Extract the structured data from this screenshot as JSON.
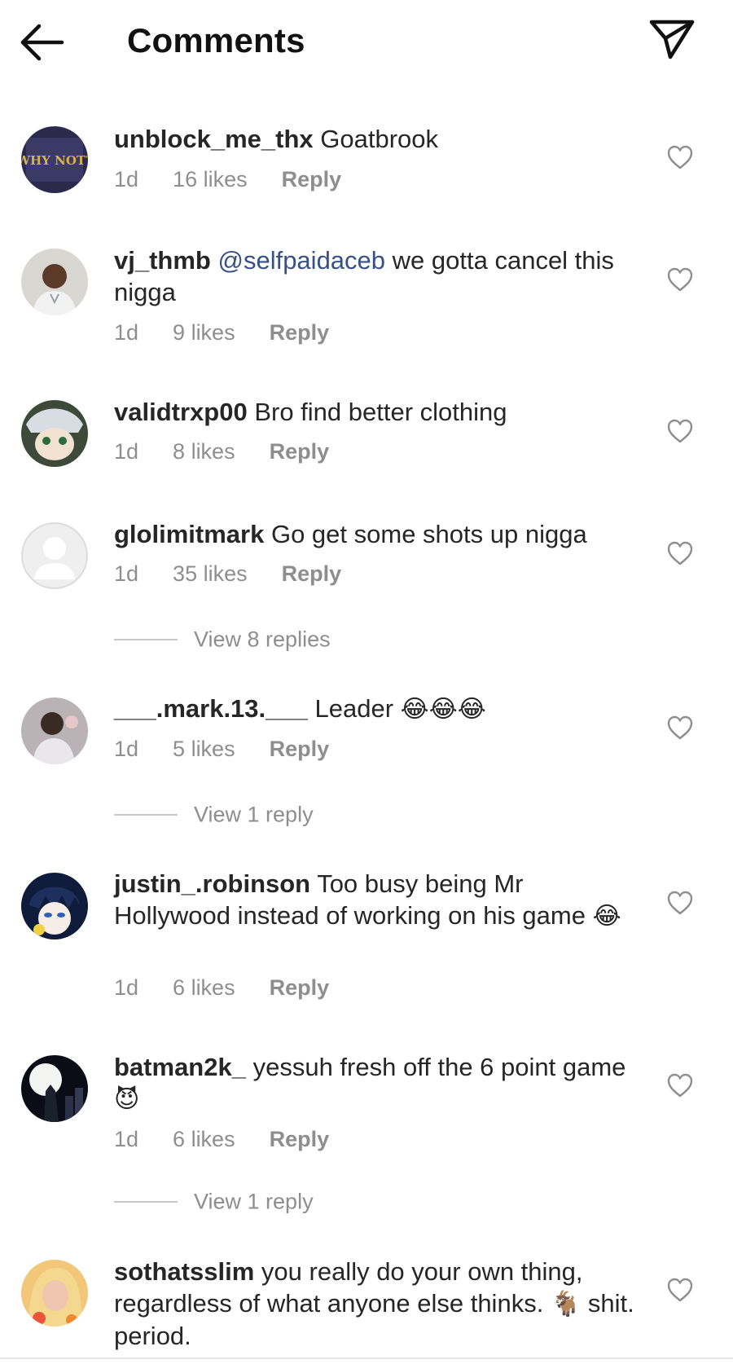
{
  "header": {
    "title": "Comments"
  },
  "comments": [
    {
      "username": "unblock_me_thx",
      "text": "Goatbrook",
      "time": "1d",
      "likes": "16 likes",
      "reply": "Reply"
    },
    {
      "username": "vj_thmb",
      "mention": "@selfpaidaceb",
      "text": "we gotta cancel this nigga",
      "time": "1d",
      "likes": "9 likes",
      "reply": "Reply"
    },
    {
      "username": "validtrxp00",
      "text": "Bro find better clothing",
      "time": "1d",
      "likes": "8 likes",
      "reply": "Reply"
    },
    {
      "username": "glolimitmark",
      "text": "Go get some shots up nigga",
      "time": "1d",
      "likes": "35 likes",
      "reply": "Reply",
      "view_replies": "View 8 replies"
    },
    {
      "username": "___.mark.13.___",
      "text": "Leader",
      "emoji": "😂😂😂",
      "time": "1d",
      "likes": "5 likes",
      "reply": "Reply",
      "view_replies": "View 1 reply"
    },
    {
      "username": "justin_.robinson",
      "text": "Too busy being Mr Hollywood instead of  working on his game",
      "emoji": "😂",
      "time": "1d",
      "likes": "6 likes",
      "reply": "Reply"
    },
    {
      "username": "batman2k_",
      "text": "yessuh fresh off the 6 point game",
      "emoji": "😈",
      "time": "1d",
      "likes": "6 likes",
      "reply": "Reply",
      "view_replies": "View 1 reply"
    },
    {
      "username": "sothatsslim",
      "text": "you really do your own thing, regardless of what anyone else thinks.",
      "emoji": "🐐",
      "text2": "shit. period."
    }
  ],
  "avatars": {
    "c0": "WHY NOT?"
  },
  "icons": {
    "back": "arrow-left-icon",
    "send": "paper-plane-icon",
    "heart": "heart-outline-icon"
  },
  "colors": {
    "text": "#262626",
    "meta": "#8e8e8e",
    "mention": "#385185",
    "divider": "#c7c7c7"
  }
}
